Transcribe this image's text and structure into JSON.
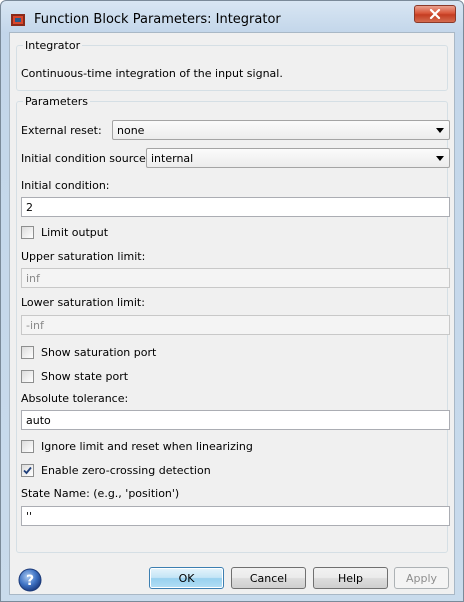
{
  "window": {
    "title": "Function Block Parameters: Integrator"
  },
  "block": {
    "group_title": "Integrator",
    "description": "Continuous-time integration of the input signal."
  },
  "parameters": {
    "group_title": "Parameters",
    "external_reset": {
      "label": "External reset:",
      "value": "none"
    },
    "ic_source": {
      "label": "Initial condition source:",
      "value": "internal"
    },
    "initial_condition": {
      "label": "Initial condition:",
      "value": "2"
    },
    "limit_output": {
      "label": "Limit output",
      "checked": false
    },
    "upper_limit": {
      "label": "Upper saturation limit:",
      "value": "inf"
    },
    "lower_limit": {
      "label": "Lower saturation limit:",
      "value": "-inf"
    },
    "show_saturation_port": {
      "label": "Show saturation port",
      "checked": false
    },
    "show_state_port": {
      "label": "Show state port",
      "checked": false
    },
    "absolute_tolerance": {
      "label": "Absolute tolerance:",
      "value": "auto"
    },
    "ignore_limit": {
      "label": "Ignore limit and reset when linearizing",
      "checked": false
    },
    "zero_crossing": {
      "label": "Enable zero-crossing detection",
      "checked": true
    },
    "state_name": {
      "label": "State Name: (e.g., 'position')",
      "value": "''"
    }
  },
  "buttons": {
    "ok": "OK",
    "cancel": "Cancel",
    "help": "Help",
    "apply": "Apply"
  },
  "icons": {
    "app": "simulink-block-icon",
    "close": "close-icon",
    "help": "help-icon",
    "dropdown": "chevron-down-icon",
    "check": "checkmark-icon"
  }
}
